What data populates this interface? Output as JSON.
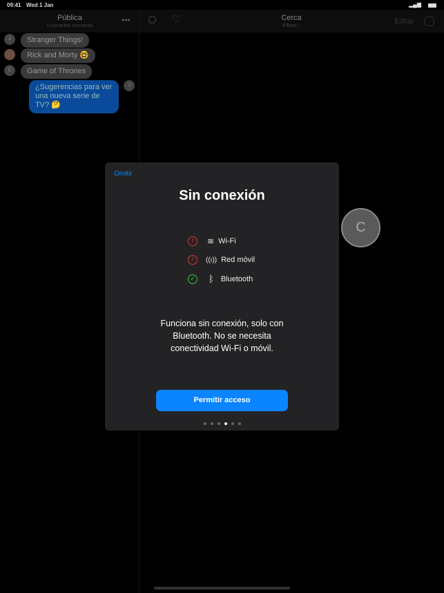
{
  "status": {
    "time": "09:41",
    "date": "Wed 1 Jan"
  },
  "left": {
    "title": "Pública",
    "subtitle": "0 usuarios cercanos",
    "messages": [
      {
        "avatar": "J",
        "text": "Stranger Things!"
      },
      {
        "avatar": "",
        "text": "Rick and Morty 🤓"
      },
      {
        "avatar": "C",
        "text": "Game of Thrones"
      }
    ],
    "own": {
      "avatar": "J",
      "text": "¿Sugerencias para ver una nueva serie de TV? 🤔"
    }
  },
  "right": {
    "title": "Cerca",
    "subtitle": "Filtros ›",
    "edit": "Editar"
  },
  "nearby_avatar": "C",
  "modal": {
    "skip": "Omitir",
    "title": "Sin conexión",
    "items": [
      {
        "label": "Wi-Fi",
        "ok": false
      },
      {
        "label": "Red móvil",
        "ok": false
      },
      {
        "label": "Bluetooth",
        "ok": true
      }
    ],
    "body": "Funciona sin conexión, solo con Bluetooth. No se necesita conectividad Wi-Fi o móvil.",
    "button": "Permitir acceso",
    "pages": 6,
    "current_page": 4
  },
  "colors": {
    "accent": "#0a84ff",
    "error": "#e0342b",
    "success": "#30c93a"
  }
}
